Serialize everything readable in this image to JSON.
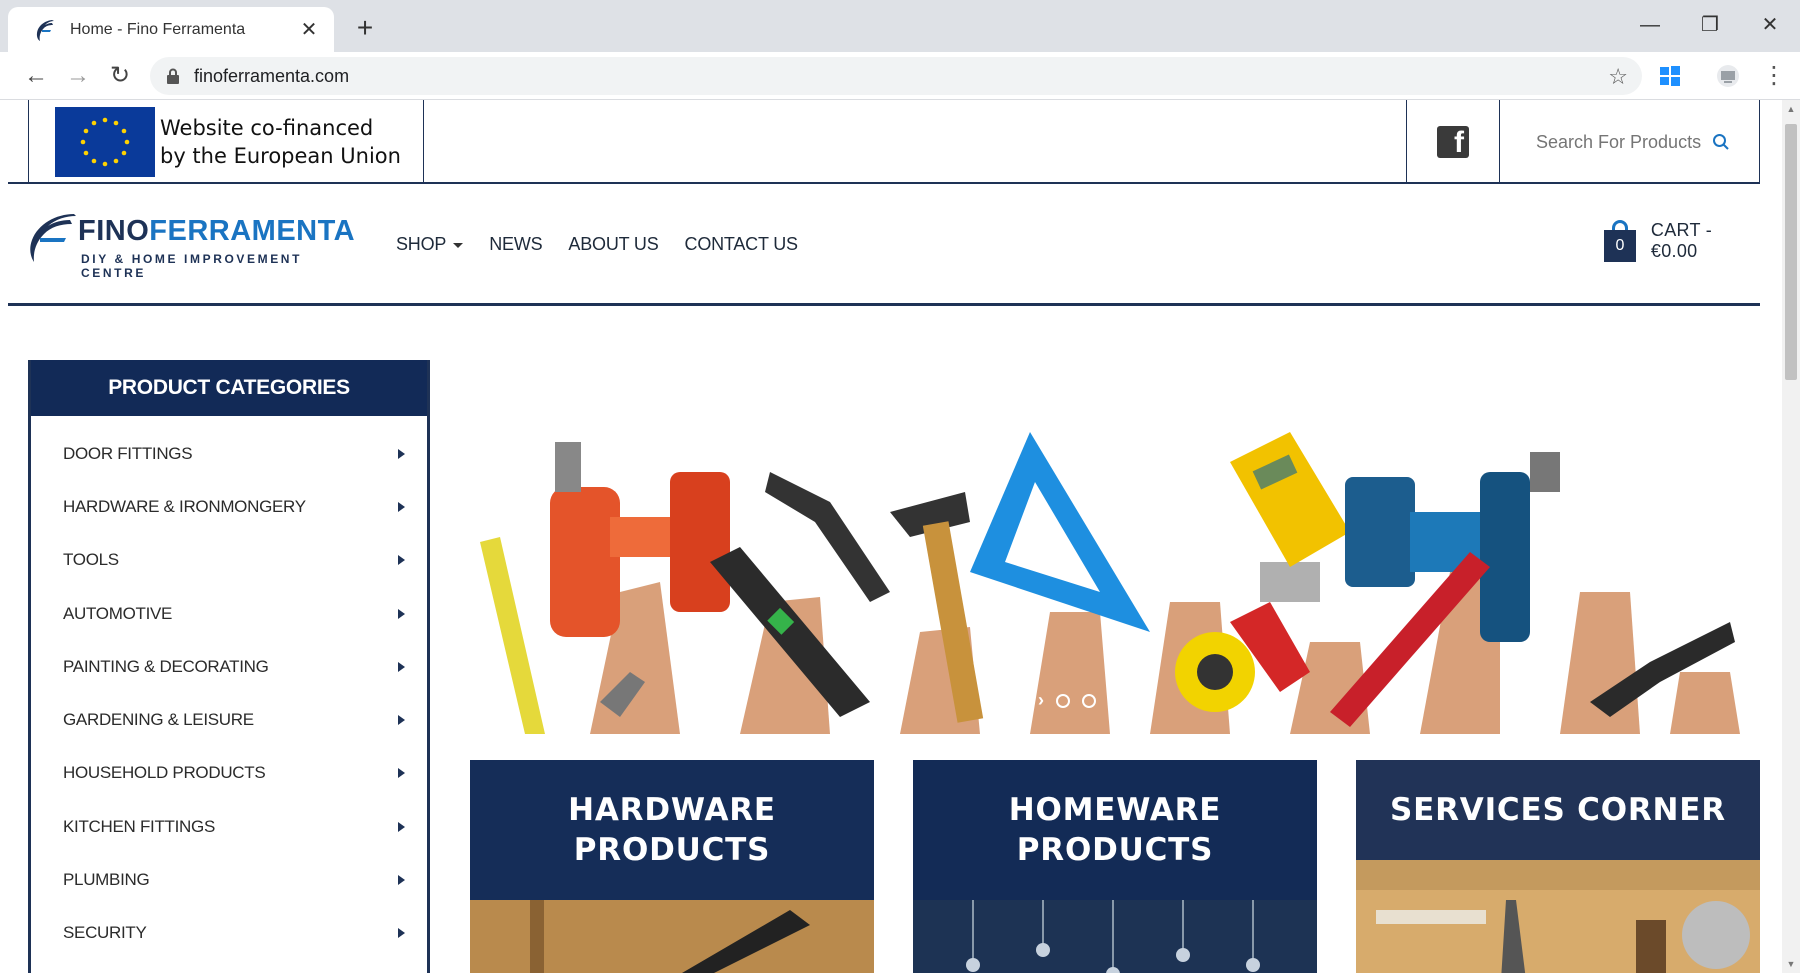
{
  "browser": {
    "tab_title": "Home - Fino Ferramenta",
    "url": "finoferramenta.com"
  },
  "topbar": {
    "eu_line1": "Website co-financed",
    "eu_line2": "by the European Union",
    "search_placeholder": "Search For Products"
  },
  "header": {
    "brand_part1": "FINO",
    "brand_part2": "FERRAMENTA",
    "tagline": "DIY & HOME IMPROVEMENT CENTRE",
    "nav": {
      "shop": "SHOP",
      "news": "NEWS",
      "about": "ABOUT US",
      "contact": "CONTACT US"
    },
    "cart_count": "0",
    "cart_label": "CART - €0.00"
  },
  "sidebar": {
    "title": "PRODUCT CATEGORIES",
    "items": [
      {
        "label": "DOOR FITTINGS"
      },
      {
        "label": "HARDWARE & IRONMONGERY"
      },
      {
        "label": "TOOLS"
      },
      {
        "label": "AUTOMOTIVE"
      },
      {
        "label": "PAINTING & DECORATING"
      },
      {
        "label": "GARDENING & LEISURE"
      },
      {
        "label": "HOUSEHOLD PRODUCTS"
      },
      {
        "label": "KITCHEN FITTINGS"
      },
      {
        "label": "PLUMBING"
      },
      {
        "label": "SECURITY"
      }
    ]
  },
  "slider": {
    "dot_count": 3,
    "active_dot": 2
  },
  "tiles": [
    {
      "line1": "HARDWARE",
      "line2": "PRODUCTS"
    },
    {
      "line1": "HOMEWARE",
      "line2": "PRODUCTS"
    },
    {
      "line1": "SERVICES CORNER",
      "line2": ""
    }
  ],
  "colors": {
    "navy": "#122a57",
    "brand_blue": "#1a74c2",
    "border": "#1e3256"
  }
}
